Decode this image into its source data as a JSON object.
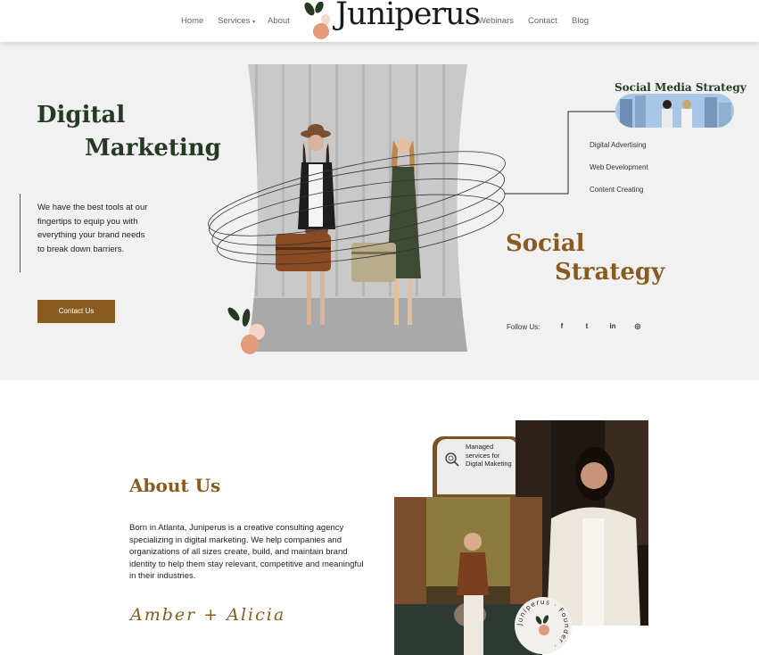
{
  "nav": {
    "home": "Home",
    "services": "Services",
    "services_caret": "▾",
    "about": "About",
    "logo": "Juniperus",
    "webinars": "Webinars",
    "contact": "Contact",
    "blog": "Blog"
  },
  "hero": {
    "title_line1": "Digital",
    "title_line2": "Marketing",
    "description": "We have the best tools at our fingertips to equip you with everything your brand needs to break down barriers.",
    "cta": "Contact Us",
    "side_heading": "Social Media Strategy",
    "services": [
      "Digital Advertising",
      "Web Development",
      "Content Creating"
    ],
    "social_line1": "Social",
    "social_line2": "Strategy",
    "follow_label": "Follow Us:",
    "social_icons": [
      "facebook-icon",
      "twitter-icon",
      "linkedin-icon",
      "instagram-icon"
    ],
    "social_glyphs": [
      "f",
      "t",
      "in",
      "◎"
    ]
  },
  "about": {
    "title": "About Us",
    "body": "Born in Atlanta, Juniperus is a creative consulting agency specializing in digital marketing. We help companies and organizations of all sizes create, build, and maintain brand identity to help them stay relevant, competitive and meaningful in their industries.",
    "signature": "Amber + Alicia",
    "card_text": "Managed services for Digtal Maketing",
    "badge_text": "Juniperus · Founder ·"
  },
  "colors": {
    "brand_green": "#243a22",
    "brand_brown": "#8a5b1f",
    "peach": "#e39a7a",
    "hero_bg": "#f1f1f1"
  }
}
